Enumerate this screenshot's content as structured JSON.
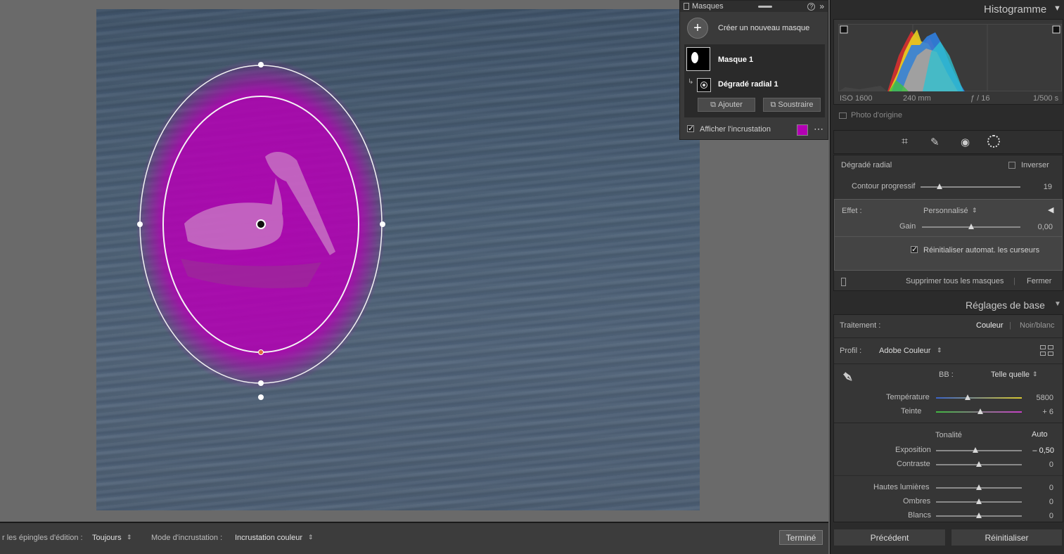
{
  "toolbar_bottom": {
    "pins_label": "r les épingles d'édition :",
    "pins_value": "Toujours",
    "overlay_mode_label": "Mode d'incrustation :",
    "overlay_mode_value": "Incrustation couleur",
    "done_label": "Terminé"
  },
  "masks_panel": {
    "title": "Masques",
    "create_label": "Créer un nouveau masque",
    "mask_name": "Masque 1",
    "component_name": "Dégradé radial 1",
    "add_label": "Ajouter",
    "subtract_label": "Soustraire",
    "show_overlay_label": "Afficher l'incrustation",
    "show_overlay_checked": true,
    "overlay_color": "#b400b4"
  },
  "histogram": {
    "title": "Histogramme",
    "iso": "ISO 1600",
    "focal": "240 mm",
    "aperture": "ƒ / 16",
    "shutter": "1/500 s",
    "original_photo_label": "Photo d'origine"
  },
  "mask_settings": {
    "type_label": "Dégradé radial",
    "invert_label": "Inverser",
    "feather_label": "Contour progressif",
    "feather_value": "19",
    "feather_level": 0.19,
    "effect_label": "Effet :",
    "effect_value": "Personnalisé",
    "gain_label": "Gain",
    "gain_value": "0,00",
    "gain_level": 0.5,
    "auto_reset_label": "Réinitialiser automat. les curseurs",
    "delete_all_label": "Supprimer tous les masques",
    "close_label": "Fermer"
  },
  "basic": {
    "title": "Réglages de base",
    "treatment_label": "Traitement :",
    "color_label": "Couleur",
    "bw_label": "Noir/blanc",
    "profile_label": "Profil :",
    "profile_value": "Adobe Couleur",
    "wb_label": "BB :",
    "wb_value": "Telle quelle",
    "temp_label": "Température",
    "temp_value": "5800",
    "temp_level": 0.37,
    "tint_label": "Teinte",
    "tint_value": "+ 6",
    "tint_level": 0.52,
    "tone_label": "Tonalité",
    "auto_label": "Auto",
    "exposure_label": "Exposition",
    "exposure_value": "– 0,50",
    "exposure_level": 0.46,
    "contrast_label": "Contraste",
    "contrast_value": "0",
    "highlights_label": "Hautes lumières",
    "highlights_value": "0",
    "shadows_label": "Ombres",
    "shadows_value": "0",
    "whites_label": "Blancs",
    "whites_value": "0"
  },
  "footer": {
    "previous_label": "Précédent",
    "reset_label": "Réinitialiser"
  },
  "icons": [
    "plus-icon",
    "help-icon",
    "expand-icon",
    "crop-icon",
    "heal-icon",
    "redeye-icon",
    "mask-icon",
    "eyedropper-icon",
    "grid-icon"
  ]
}
